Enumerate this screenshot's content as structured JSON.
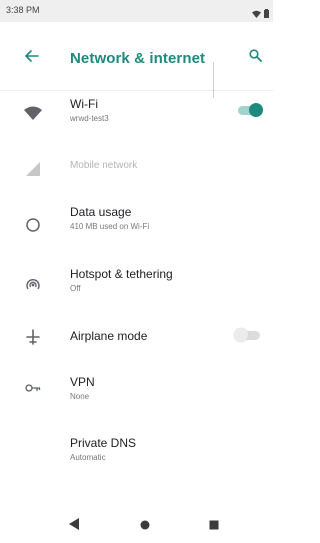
{
  "status_bar": {
    "time": "3:38 PM",
    "icons": [
      "wifi-icon",
      "battery-icon"
    ]
  },
  "app_bar": {
    "title": "Network & internet",
    "back_icon": "arrow-back-icon",
    "search_icon": "search-icon",
    "accent_color": "#1e8a7d"
  },
  "items": [
    {
      "id": "wifi",
      "title": "Wi-Fi",
      "subtitle": "wrwd-test3",
      "icon": "wifi-icon",
      "toggle": true,
      "toggle_on": true
    },
    {
      "id": "mobile",
      "title": "Mobile network",
      "subtitle": "",
      "icon": "signal-icon",
      "disabled": true
    },
    {
      "id": "data-usage",
      "title": "Data usage",
      "subtitle": "410 MB used on Wi-Fi",
      "icon": "data-usage-icon"
    },
    {
      "id": "hotspot",
      "title": "Hotspot & tethering",
      "subtitle": "Off",
      "icon": "hotspot-icon"
    },
    {
      "id": "airplane",
      "title": "Airplane mode",
      "subtitle": "",
      "icon": "airplane-icon",
      "toggle": true,
      "toggle_on": false
    },
    {
      "id": "vpn",
      "title": "VPN",
      "subtitle": "None",
      "icon": "vpn-key-icon"
    },
    {
      "id": "private-dns",
      "title": "Private DNS",
      "subtitle": "Automatic",
      "icon": ""
    }
  ],
  "nav_bar": {
    "icons": [
      "back-triangle-icon",
      "home-circle-icon",
      "recents-square-icon"
    ]
  },
  "colors": {
    "accent": "#1e8a7d",
    "icon_gray": "#5f6368",
    "disabled_gray": "#b5b5b5"
  }
}
